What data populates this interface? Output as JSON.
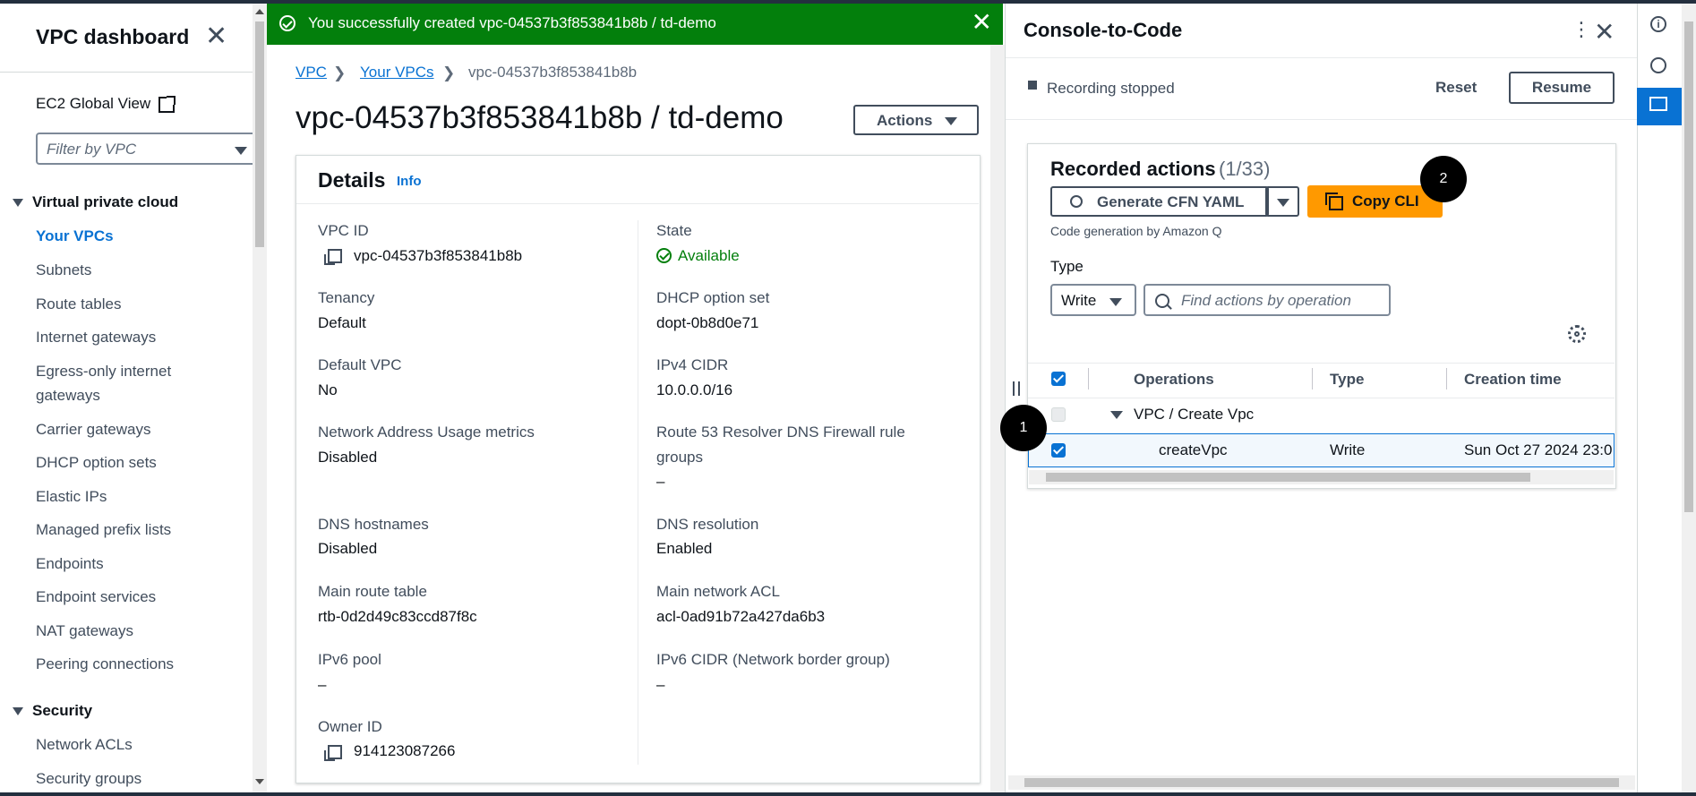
{
  "sidebar": {
    "title": "VPC dashboard",
    "ec2_global_view": "EC2 Global View",
    "filter_placeholder": "Filter by VPC",
    "section_vpc": "Virtual private cloud",
    "items_vpc": [
      "Your VPCs",
      "Subnets",
      "Route tables",
      "Internet gateways",
      "Egress-only internet",
      "gateways",
      "Carrier gateways",
      "DHCP option sets",
      "Elastic IPs",
      "Managed prefix lists",
      "Endpoints",
      "Endpoint services",
      "NAT gateways",
      "Peering connections"
    ],
    "section_security": "Security",
    "items_security": [
      "Network ACLs",
      "Security groups"
    ]
  },
  "banner": {
    "text": "You successfully created vpc-04537b3f853841b8b / td-demo"
  },
  "breadcrumb": {
    "items": [
      "VPC",
      "Your VPCs",
      "vpc-04537b3f853841b8b"
    ]
  },
  "page": {
    "title": "vpc-04537b3f853841b8b / td-demo",
    "actions_label": "Actions"
  },
  "details": {
    "title": "Details",
    "info": "Info",
    "left": [
      {
        "label": "VPC ID",
        "value": "vpc-04537b3f853841b8b"
      },
      {
        "label": "Tenancy",
        "value": "Default"
      },
      {
        "label": "Default VPC",
        "value": "No"
      },
      {
        "label": "Network Address Usage metrics",
        "value": "Disabled"
      },
      {
        "label": "DNS hostnames",
        "value": "Disabled"
      },
      {
        "label": "Main route table",
        "value": "rtb-0d2d49c83ccd87f8c"
      },
      {
        "label": "IPv6 pool",
        "value": "–"
      },
      {
        "label": "Owner ID",
        "value": "914123087266"
      }
    ],
    "right": [
      {
        "label": "State",
        "value": "Available"
      },
      {
        "label": "DHCP option set",
        "value": "dopt-0b8d0e71"
      },
      {
        "label": "IPv4 CIDR",
        "value": "10.0.0.0/16"
      },
      {
        "label": "Route 53 Resolver DNS Firewall rule",
        "label2": "groups",
        "value": "–"
      },
      {
        "label": "DNS resolution",
        "value": "Enabled"
      },
      {
        "label": "Main network ACL",
        "value": "acl-0ad91b72a427da6b3"
      },
      {
        "label": "IPv6 CIDR (Network border group)",
        "value": "–"
      }
    ]
  },
  "console": {
    "title": "Console-to-Code",
    "recording_status": "Recording stopped",
    "reset": "Reset",
    "resume": "Resume",
    "recorded_title": "Recorded actions",
    "recorded_count": "(1/33)",
    "generate_label": "Generate CFN YAML",
    "copy_cli_label": "Copy CLI",
    "codegen_note": "Code generation by Amazon Q",
    "type_label": "Type",
    "type_value": "Write",
    "find_placeholder": "Find actions by operation",
    "columns": [
      "Operations",
      "Type",
      "Creation time"
    ],
    "group_label": "VPC / Create Vpc",
    "row": {
      "operation": "createVpc",
      "type": "Write",
      "creation_time": "Sun Oct 27 2024 23:0"
    },
    "badge1": "1",
    "badge2": "2"
  },
  "icons": [
    "close-icon",
    "external-link-icon",
    "chevron-down-icon",
    "success-icon",
    "copy-icon",
    "check-circle-icon",
    "search-icon",
    "settings-icon",
    "info-icon",
    "amazon-q-icon",
    "code-icon"
  ],
  "colors": {
    "success": "#037f0c",
    "link": "#0972d3",
    "primary_button": "#ff9900",
    "nav_dark": "#232f3e"
  }
}
